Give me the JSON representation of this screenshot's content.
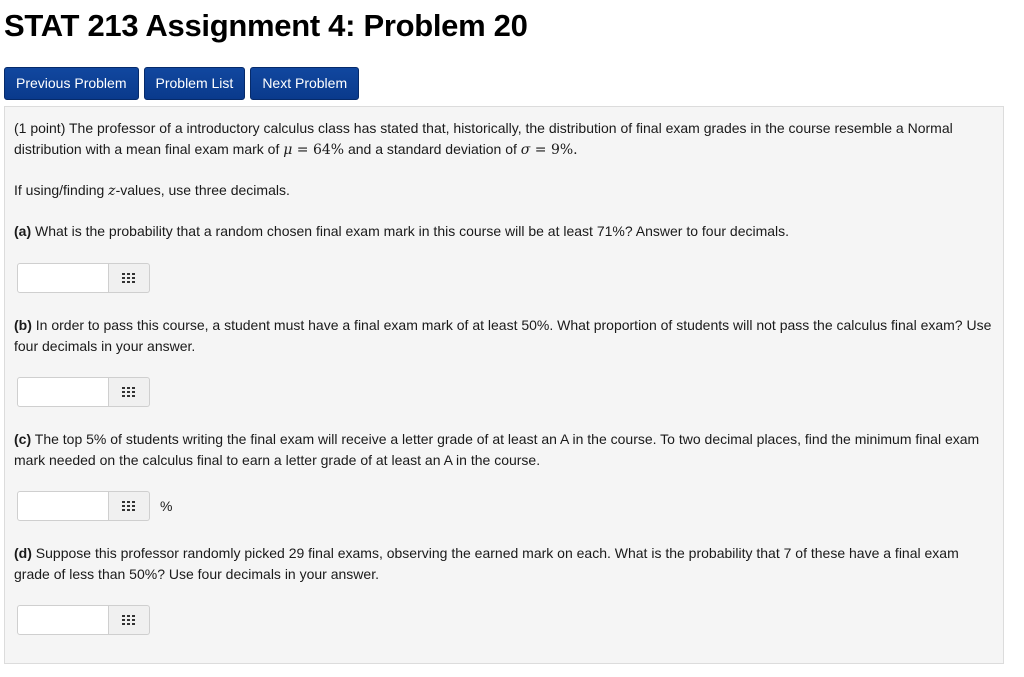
{
  "page": {
    "title": "STAT 213 Assignment 4: Problem 20"
  },
  "nav": {
    "previous": "Previous Problem",
    "list": "Problem List",
    "next": "Next Problem"
  },
  "problem": {
    "intro_points": "(1 point)",
    "intro_text1": " The professor of a introductory calculus class has stated that, historically, the distribution of final exam grades in the course resemble a Normal distribution with a mean final exam mark of ",
    "mu_symbol": "μ",
    "mu_value": " = 64%",
    "intro_text2": " and a standard deviation of ",
    "sigma_symbol": "σ",
    "sigma_value": " = 9%.",
    "z_note_pre": "If using/finding ",
    "z_symbol": "z",
    "z_note_post": "-values, use three decimals.",
    "parts": [
      {
        "label": "(a)",
        "text": " What is the probability that a random chosen final exam mark in this course will be at least 71%? Answer to four decimals.",
        "value": "",
        "unit": ""
      },
      {
        "label": "(b)",
        "text": " In order to pass this course, a student must have a final exam mark of at least 50%. What proportion of students will not pass the calculus final exam? Use four decimals in your answer.",
        "value": "",
        "unit": ""
      },
      {
        "label": "(c)",
        "text": " The top 5% of students writing the final exam will receive a letter grade of at least an A in the course. To two decimal places, find the minimum final exam mark needed on the calculus final to earn a letter grade of at least an A in the course.",
        "value": "",
        "unit": "%"
      },
      {
        "label": "(d)",
        "text": " Suppose this professor randomly picked 29 final exams, observing the earned mark on each. What is the probability that 7 of these have a final exam grade of less than 50%? Use four decimals in your answer.",
        "value": "",
        "unit": ""
      }
    ]
  },
  "icons": {
    "answer_tool": "grid-icon"
  },
  "colors": {
    "nav_button": "#0a3a8c",
    "panel_bg": "#f5f5f5"
  }
}
